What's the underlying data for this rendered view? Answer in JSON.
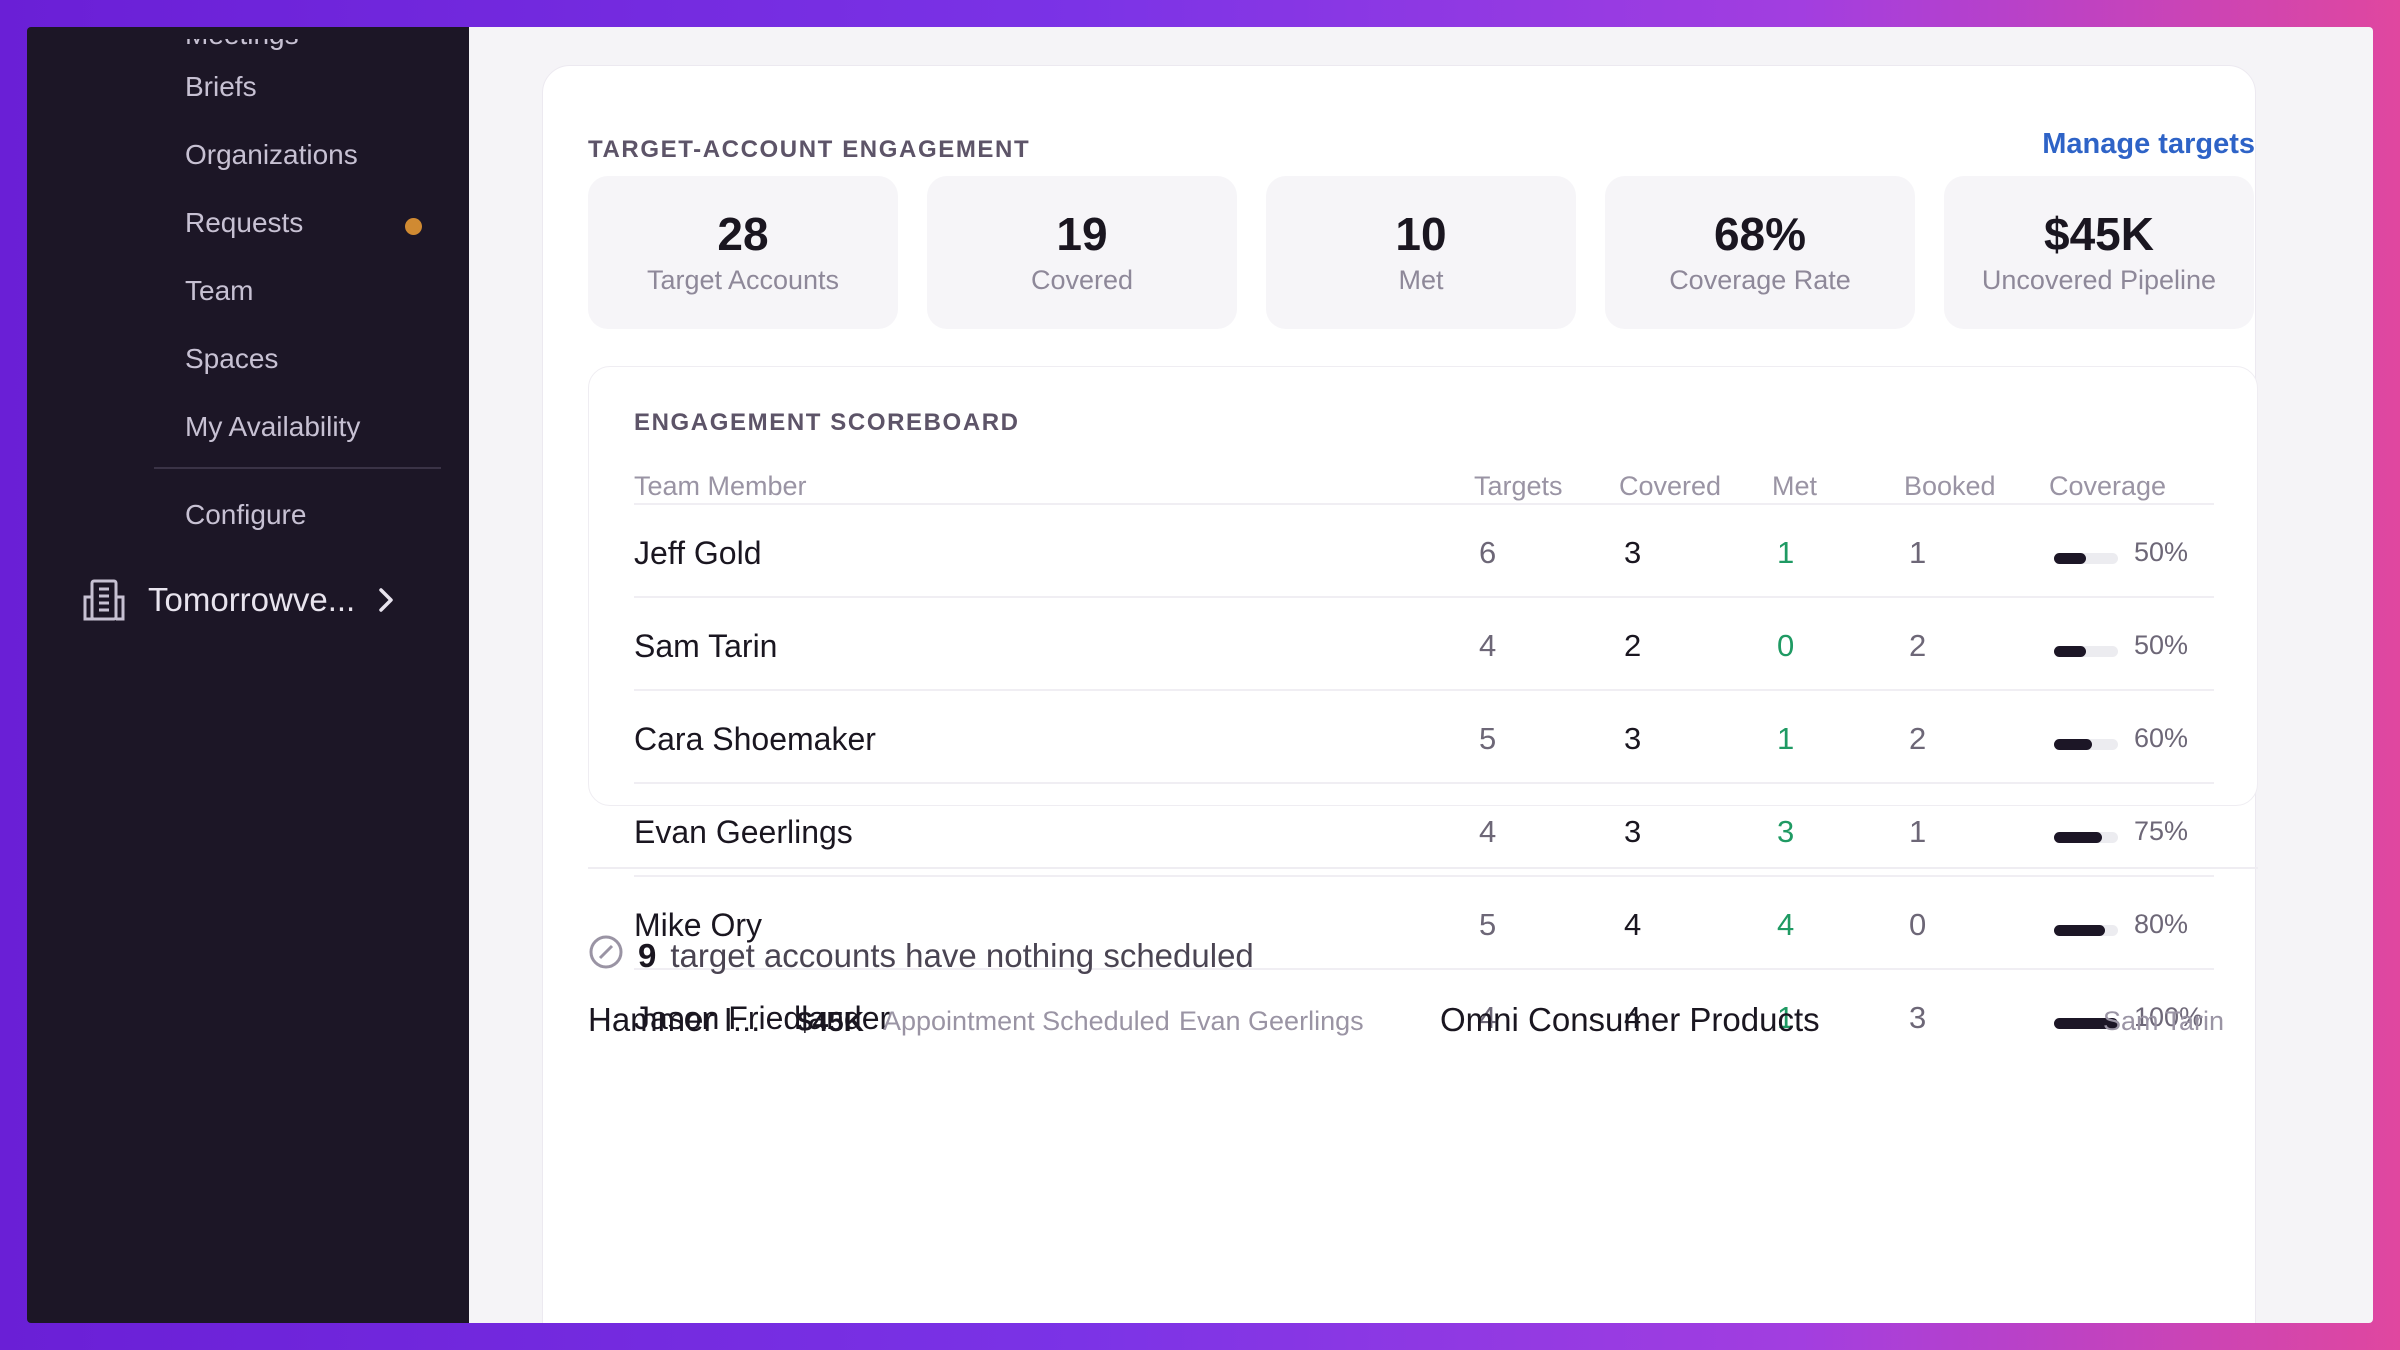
{
  "sidebar": {
    "items": [
      {
        "label": "Meetings"
      },
      {
        "label": "Briefs"
      },
      {
        "label": "Organizations"
      },
      {
        "label": "Requests",
        "has_badge": true
      },
      {
        "label": "Team"
      },
      {
        "label": "Spaces"
      },
      {
        "label": "My Availability"
      },
      {
        "label": "Configure"
      }
    ],
    "org": {
      "label": "Tomorrowve...",
      "icon": "building-icon",
      "chevron": "chevron-right-icon"
    },
    "badge_color": "#d08a32"
  },
  "engagement": {
    "title": "TARGET-ACCOUNT ENGAGEMENT",
    "manage_label": "Manage targets",
    "stats": [
      {
        "value": "28",
        "label": "Target Accounts"
      },
      {
        "value": "19",
        "label": "Covered"
      },
      {
        "value": "10",
        "label": "Met"
      },
      {
        "value": "68%",
        "label": "Coverage Rate"
      },
      {
        "value": "$45K",
        "label": "Uncovered Pipeline"
      }
    ]
  },
  "scoreboard": {
    "title": "ENGAGEMENT SCOREBOARD",
    "columns": [
      "Team Member",
      "Targets",
      "Covered",
      "Met",
      "Booked",
      "Coverage"
    ],
    "rows": [
      {
        "name": "Jeff Gold",
        "targets": "6",
        "covered": "3",
        "met": "1",
        "booked": "1",
        "coverage": "50%",
        "coverage_fraction": 0.5
      },
      {
        "name": "Sam Tarin",
        "targets": "4",
        "covered": "2",
        "met": "0",
        "booked": "2",
        "coverage": "50%",
        "coverage_fraction": 0.5
      },
      {
        "name": "Cara Shoemaker",
        "targets": "5",
        "covered": "3",
        "met": "1",
        "booked": "2",
        "coverage": "60%",
        "coverage_fraction": 0.6
      },
      {
        "name": "Evan Geerlings",
        "targets": "4",
        "covered": "3",
        "met": "3",
        "booked": "1",
        "coverage": "75%",
        "coverage_fraction": 0.75
      },
      {
        "name": "Mike Ory",
        "targets": "5",
        "covered": "4",
        "met": "4",
        "booked": "0",
        "coverage": "80%",
        "coverage_fraction": 0.8
      },
      {
        "name": "Jason Friedlander",
        "targets": "4",
        "covered": "4",
        "met": "1",
        "booked": "3",
        "coverage": "100%",
        "coverage_fraction": 1.0
      }
    ],
    "met_color": "#1f9a63"
  },
  "unscheduled": {
    "count": "9",
    "text": "target accounts have nothing scheduled",
    "accounts": [
      {
        "name": "Hammer I...",
        "amount": "$45K",
        "stage": "Appointment Scheduled",
        "owner": "Evan Geerlings"
      },
      {
        "name": "Omni Consumer Products",
        "owner": "Sam Tarin"
      }
    ]
  },
  "colors": {
    "accent_link": "#2e63c7",
    "sidebar_bg": "#1c1626"
  }
}
